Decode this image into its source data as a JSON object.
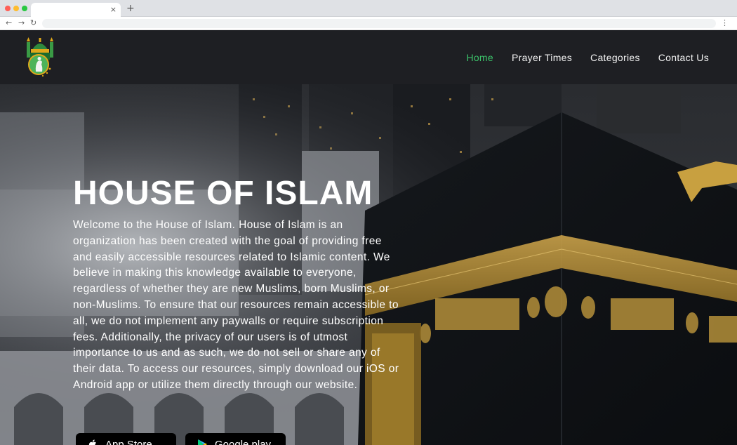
{
  "browser": {
    "tab_close": "×",
    "new_tab": "+",
    "back": "←",
    "forward": "→",
    "reload": "↻",
    "menu": "⋮"
  },
  "header": {
    "logo_icon": "mosque-logo-icon",
    "nav": [
      {
        "label": "Home",
        "active": true
      },
      {
        "label": "Prayer Times",
        "active": false
      },
      {
        "label": "Categories",
        "active": false
      },
      {
        "label": "Contact Us",
        "active": false
      }
    ]
  },
  "hero": {
    "title": "HOUSE OF ISLAM",
    "description": "Welcome to the House of Islam. House of Islam is an organization has been created with the goal of providing free and easily accessible resources related to Islamic content. We believe in making this knowledge available to everyone, regardless of whether they are new Muslims, born Muslims, or non-Muslims. To ensure that our resources remain accessible to all, we do not implement any paywalls or require subscription fees. Additionally, the privacy of our users is of utmost importance to us and as such, we do not sell or share any of their data. To access our resources, simply download our iOS or Android app or utilize them directly through our website.",
    "buttons": [
      {
        "label": "App Store",
        "icon": "apple-icon"
      },
      {
        "label": "Google play",
        "icon": "google-play-icon"
      }
    ]
  },
  "colors": {
    "header_bg": "#1e1f23",
    "nav_active": "#3cc46b",
    "nav_text": "#f1f1f1"
  }
}
